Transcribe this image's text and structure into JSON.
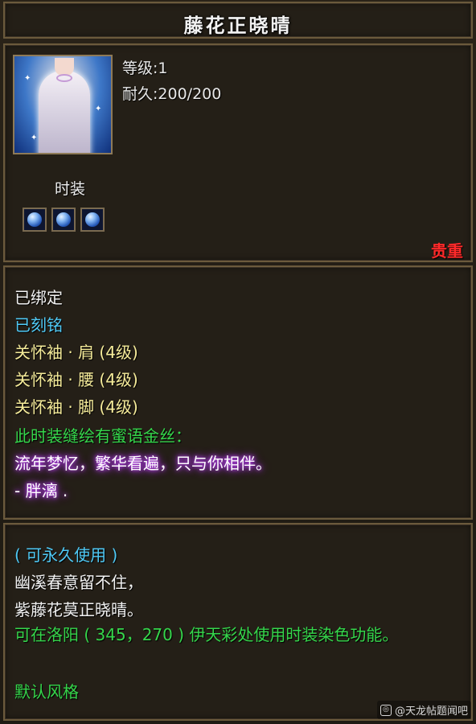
{
  "title": "藤花正晓晴",
  "item": {
    "icon": "white-dress-costume-icon",
    "level_text": "等级:1",
    "durability_text": "耐久:200/200"
  },
  "slot_section": {
    "label": "时装",
    "gems": [
      "blue-gem-icon",
      "blue-gem-icon",
      "blue-gem-icon"
    ]
  },
  "rarity": "贵重",
  "attributes": {
    "bound": "已绑定",
    "engraved": "已刻铭",
    "bonus_lines": [
      "关怀袖 · 肩 (4级)",
      "关怀袖 · 腰 (4级)",
      "关怀袖 · 脚 (4级)"
    ],
    "embroidery_intro": "此时装缝绘有蜜语金丝：",
    "poem": "流年梦忆，繁华看遍，只与你相伴。",
    "signature": "- 胖漓 ."
  },
  "description": {
    "duration": "( 可永久使用 )",
    "verse_1": "幽溪春意留不住，",
    "verse_2": "紫藤花莫正晓晴。",
    "usage": "可在洛阳 ( 345，270 ) 伊天彩处使用时装染色功能。",
    "style": "默认风格"
  },
  "watermark": "@天龙帖题闻吧",
  "colors": {
    "rarity": "#ff2a2a",
    "engraved": "#4fc9f5",
    "bonus": "#f6ec9a",
    "green": "#35d64b",
    "poem_glow": "#b23ee8"
  }
}
